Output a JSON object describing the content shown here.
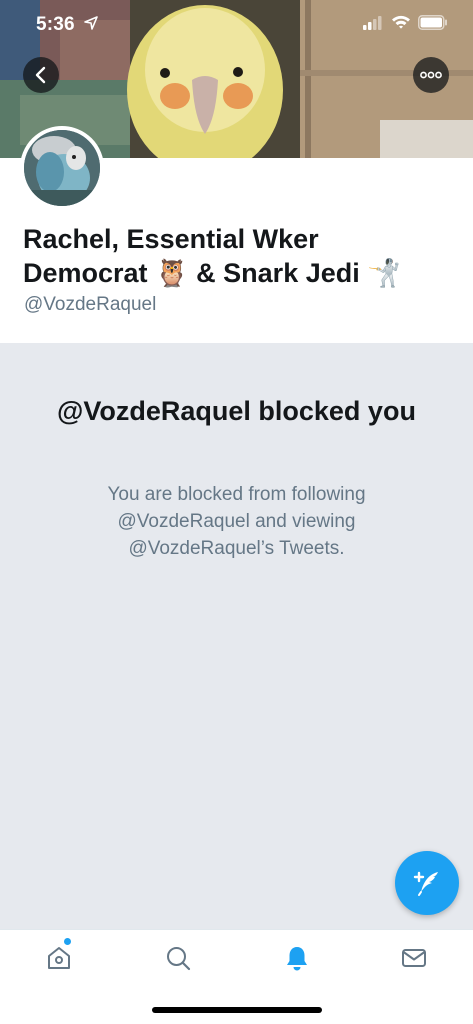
{
  "status_bar": {
    "time": "5:36"
  },
  "header": {
    "back_icon": "chevron-left-icon",
    "more_icon": "more-dots-icon"
  },
  "profile": {
    "display_name_line1": "Rachel, Essential Wker",
    "display_name_line2": "Democrat 🦉 & Snark Jedi 🤺",
    "handle": "@VozdeRaquel"
  },
  "blocked": {
    "title": "@VozdeRaquel blocked you",
    "body": "You are blocked from following @VozdeRaquel and viewing @VozdeRaquel’s Tweets."
  },
  "fab": {
    "icon": "compose-tweet-icon"
  },
  "tabbar": {
    "items": [
      {
        "name": "home",
        "icon": "home-icon"
      },
      {
        "name": "search",
        "icon": "search-icon"
      },
      {
        "name": "notifications",
        "icon": "bell-icon",
        "active": true
      },
      {
        "name": "messages",
        "icon": "envelope-icon"
      }
    ]
  },
  "colors": {
    "accent": "#1da1f2",
    "text_primary": "#14171a",
    "text_secondary": "#657786",
    "blocked_bg": "#e6e9ee"
  }
}
